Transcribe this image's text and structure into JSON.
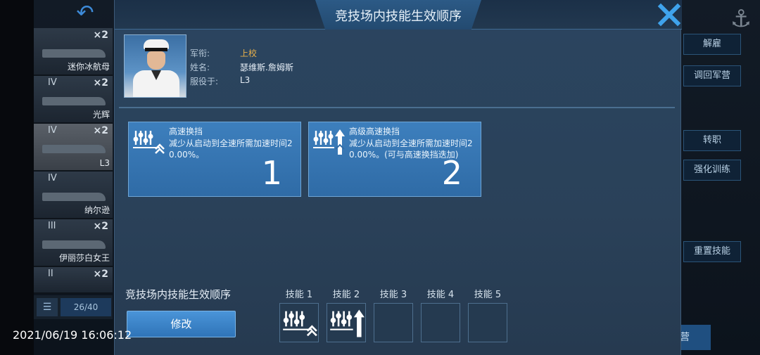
{
  "background": {
    "ships": [
      {
        "tier": "",
        "count": "×2",
        "name": "迷你冰航母"
      },
      {
        "tier": "IV",
        "count": "×2",
        "name": "光辉"
      },
      {
        "tier": "IV",
        "count": "×2",
        "name": "L3"
      },
      {
        "tier": "IV",
        "count": "",
        "name": "纳尔逊"
      },
      {
        "tier": "III",
        "count": "×2",
        "name": "伊丽莎白女王"
      },
      {
        "tier": "II",
        "count": "×2",
        "name": ""
      }
    ],
    "list_count": "26/40",
    "right_buttons": [
      "解雇",
      "调回军营",
      "转职",
      "强化训练",
      "重置技能"
    ],
    "bottom_right_fragment": "营"
  },
  "modal": {
    "title": "竞技场内技能生效顺序",
    "officer": {
      "rank_label": "军衔:",
      "rank_value": "上校",
      "name_label": "姓名:",
      "name_value": "瑟维斯.詹姆斯",
      "serve_label": "服役于:",
      "serve_value": "L3"
    },
    "skills": [
      {
        "name": "高速换挡",
        "desc": "减少从启动到全速所需加速时间20.00%。",
        "order": "1",
        "icon": "gear-shift-icon"
      },
      {
        "name": "高级高速换挡",
        "desc": "减少从启动到全速所需加速时间20.00%。(可与高速换挡迭加)",
        "order": "2",
        "icon": "advanced-gear-shift-icon"
      }
    ],
    "bottom_title": "竞技场内技能生效顺序",
    "modify_button": "修改",
    "slots": [
      {
        "label": "技能 1",
        "filled": true
      },
      {
        "label": "技能 2",
        "filled": true
      },
      {
        "label": "技能 3",
        "filled": false
      },
      {
        "label": "技能 4",
        "filled": false
      },
      {
        "label": "技能 5",
        "filled": false
      }
    ]
  },
  "timestamp": "2021/06/19 16:06:12",
  "colors": {
    "accent": "#3d8ad8",
    "rank": "#e9b04a",
    "card": "#3577b2"
  }
}
